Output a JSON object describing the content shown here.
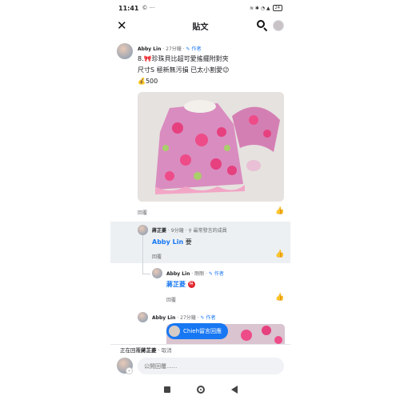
{
  "status": {
    "time": "11:41",
    "left_icons": "© ···",
    "right_icons": "≋ ✱ ◔ ▲",
    "battery": "24"
  },
  "header": {
    "title": "貼文"
  },
  "post": {
    "author": "Abby Lin",
    "time": "27分鐘",
    "author_badge": "作者",
    "lines": [
      "8.🎀珍珠貝比超可愛搖擺附對夾",
      "尺寸S 極新無污損 已太小割愛😉",
      "💰500"
    ],
    "reply": "回覆"
  },
  "comment1": {
    "author": "蔣芷菱",
    "time": "9分鐘",
    "badge": "最常發言的成員",
    "mention": "Abby Lin",
    "text": "要",
    "reply": "回覆"
  },
  "reply1": {
    "author": "Abby Lin",
    "time": "剛剛",
    "author_badge": "作者",
    "mention": "蔣芷菱",
    "sticker": "得",
    "reply": "回覆"
  },
  "reply2": {
    "author": "Abby Lin",
    "time": "27分鐘",
    "author_badge": "作者"
  },
  "toast": {
    "text": "Chieh留言回應"
  },
  "reply_bar": {
    "prefix": "正在回覆",
    "target": "蔣芷菱",
    "separator": " · ",
    "cancel": "取消"
  },
  "composer": {
    "placeholder": "公開回覆......"
  },
  "colors": {
    "accent": "#1877f2",
    "text": "#1c1e21",
    "muted": "#65676b"
  }
}
